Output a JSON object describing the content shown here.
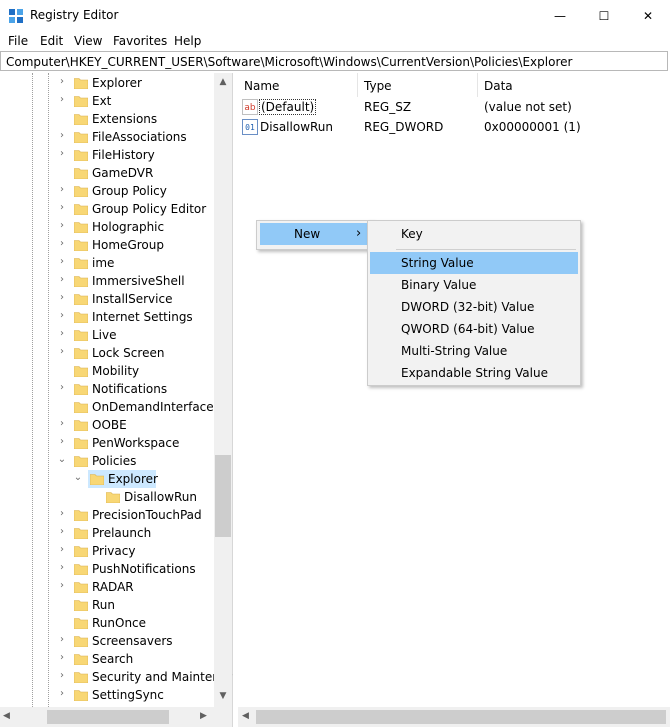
{
  "window": {
    "title": "Registry Editor"
  },
  "window_controls": {
    "minimize": "—",
    "maximize": "☐",
    "close": "✕"
  },
  "menubar": [
    "File",
    "Edit",
    "View",
    "Favorites",
    "Help"
  ],
  "address": "Computer\\HKEY_CURRENT_USER\\Software\\Microsoft\\Windows\\CurrentVersion\\Policies\\Explorer",
  "tree": [
    {
      "label": "Explorer",
      "expander": "›"
    },
    {
      "label": "Ext",
      "expander": "›"
    },
    {
      "label": "Extensions",
      "expander": ""
    },
    {
      "label": "FileAssociations",
      "expander": "›"
    },
    {
      "label": "FileHistory",
      "expander": "›"
    },
    {
      "label": "GameDVR",
      "expander": ""
    },
    {
      "label": "Group Policy",
      "expander": "›"
    },
    {
      "label": "Group Policy Editor",
      "expander": "›"
    },
    {
      "label": "Holographic",
      "expander": "›"
    },
    {
      "label": "HomeGroup",
      "expander": "›"
    },
    {
      "label": "ime",
      "expander": "›"
    },
    {
      "label": "ImmersiveShell",
      "expander": "›"
    },
    {
      "label": "InstallService",
      "expander": "›"
    },
    {
      "label": "Internet Settings",
      "expander": "›"
    },
    {
      "label": "Live",
      "expander": "›"
    },
    {
      "label": "Lock Screen",
      "expander": "›"
    },
    {
      "label": "Mobility",
      "expander": ""
    },
    {
      "label": "Notifications",
      "expander": "›"
    },
    {
      "label": "OnDemandInterfaceCa",
      "expander": ""
    },
    {
      "label": "OOBE",
      "expander": "›"
    },
    {
      "label": "PenWorkspace",
      "expander": "›"
    },
    {
      "label": "Policies",
      "expander": "⌄"
    },
    {
      "label": "Explorer",
      "expander": "⌄",
      "level": 2,
      "selected": true
    },
    {
      "label": "DisallowRun",
      "expander": "",
      "level": 3
    },
    {
      "label": "PrecisionTouchPad",
      "expander": "›"
    },
    {
      "label": "Prelaunch",
      "expander": "›"
    },
    {
      "label": "Privacy",
      "expander": "›"
    },
    {
      "label": "PushNotifications",
      "expander": "›"
    },
    {
      "label": "RADAR",
      "expander": "›"
    },
    {
      "label": "Run",
      "expander": ""
    },
    {
      "label": "RunOnce",
      "expander": ""
    },
    {
      "label": "Screensavers",
      "expander": "›"
    },
    {
      "label": "Search",
      "expander": "›"
    },
    {
      "label": "Security and Maintenar",
      "expander": "›"
    },
    {
      "label": "SettingSync",
      "expander": "›"
    }
  ],
  "scroll_arrows": {
    "up": "▲",
    "down": "▼",
    "left": "◀",
    "right": "▶"
  },
  "list": {
    "headers": [
      "Name",
      "Type",
      "Data"
    ],
    "rows": [
      {
        "icon": "ab",
        "name": "(Default)",
        "type": "REG_SZ",
        "data": "(value not set)"
      },
      {
        "icon": "01",
        "name": "DisallowRun",
        "type": "REG_DWORD",
        "data": "0x00000001 (1)"
      }
    ]
  },
  "context_menu": {
    "new_label": "New",
    "arrow": "›"
  },
  "submenu": [
    "Key",
    "String Value",
    "Binary Value",
    "DWORD (32-bit) Value",
    "QWORD (64-bit) Value",
    "Multi-String Value",
    "Expandable String Value"
  ],
  "colors": {
    "selection": "#cce8ff",
    "menu_highlight": "#91c9f7",
    "folder": "#f8d775"
  }
}
